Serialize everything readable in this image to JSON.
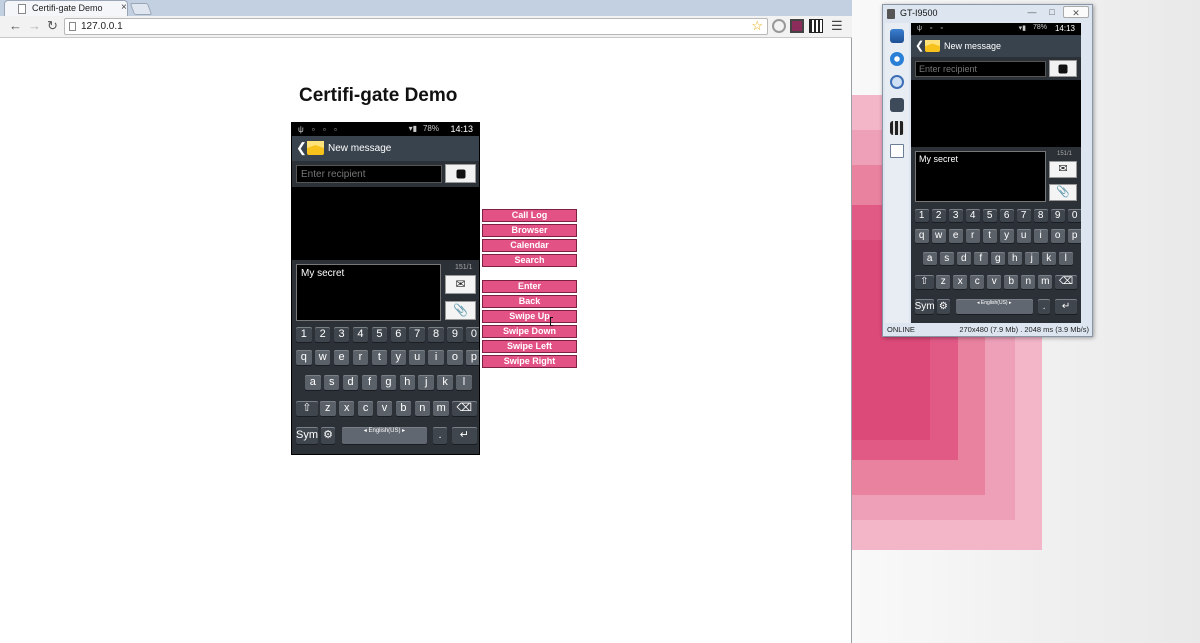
{
  "browser": {
    "tab_title": "Certifi-gate Demo",
    "tab_close": "×",
    "url": "127.0.0.1",
    "icons": [
      "back-icon",
      "forward-icon",
      "reload-icon",
      "star-icon",
      "menu-icon"
    ]
  },
  "page": {
    "title": "Certifi-gate Demo"
  },
  "phone": {
    "status_time": "14:13",
    "battery": "78%",
    "header_title": "New message",
    "recipient_placeholder": "Enter recipient",
    "message_text": "My secret",
    "char_count": "151/1",
    "keyboard": {
      "row_numbers": [
        "1",
        "2",
        "3",
        "4",
        "5",
        "6",
        "7",
        "8",
        "9",
        "0"
      ],
      "row_q": [
        "q",
        "w",
        "e",
        "r",
        "t",
        "y",
        "u",
        "i",
        "o",
        "p"
      ],
      "row_a": [
        "a",
        "s",
        "d",
        "f",
        "g",
        "h",
        "j",
        "k",
        "l"
      ],
      "row_z": [
        "z",
        "x",
        "c",
        "v",
        "b",
        "n",
        "m"
      ],
      "sym": "Sym",
      "language": "English(US)",
      "period": "."
    }
  },
  "controls": {
    "call_log": "Call Log",
    "browser": "Browser",
    "calendar": "Calendar",
    "search": "Search",
    "enter": "Enter",
    "back": "Back",
    "swipe_up": "Swipe Up",
    "swipe_down": "Swipe Down",
    "swipe_left": "Swipe Left",
    "swipe_right": "Swipe Right"
  },
  "device_window": {
    "title": "GT-I9500",
    "status_left": "ONLINE",
    "status_right": "270x480 (7.9 Mb) . 2048 ms (3.9 Mb/s)"
  },
  "colors": {
    "control_button": "#e25285",
    "phone_header": "#39434d",
    "desktop_pink": "#e15a86"
  }
}
